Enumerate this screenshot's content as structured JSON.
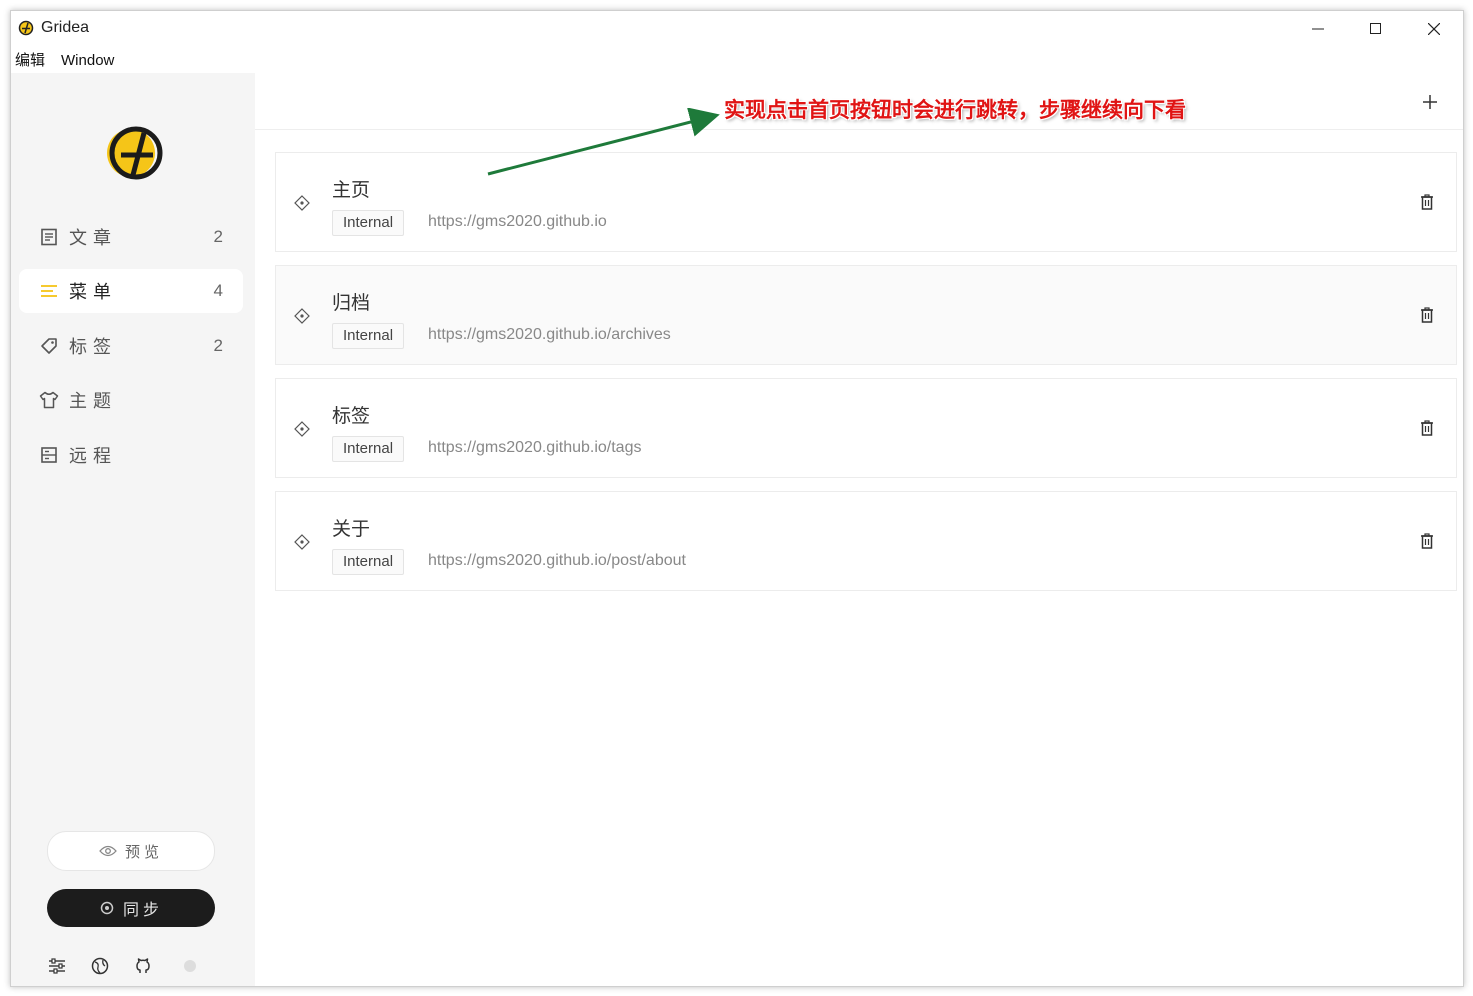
{
  "window": {
    "title": "Gridea",
    "controls": [
      "minimize",
      "maximize",
      "close"
    ]
  },
  "menubar": {
    "items": [
      "编辑",
      "Window"
    ]
  },
  "sidebar": {
    "items": [
      {
        "label": "文章",
        "count": "2",
        "icon": "article-icon",
        "active": false
      },
      {
        "label": "菜单",
        "count": "4",
        "icon": "menu-icon",
        "active": true
      },
      {
        "label": "标签",
        "count": "2",
        "icon": "tag-icon",
        "active": false
      },
      {
        "label": "主题",
        "count": "",
        "icon": "shirt-icon",
        "active": false
      },
      {
        "label": "远程",
        "count": "",
        "icon": "server-icon",
        "active": false
      }
    ],
    "preview_label": "预览",
    "sync_label": "同步",
    "accent_color": "#f5c518"
  },
  "main": {
    "menus": [
      {
        "name": "主页",
        "type": "Internal",
        "link": "https://gms2020.github.io"
      },
      {
        "name": "归档",
        "type": "Internal",
        "link": "https://gms2020.github.io/archives"
      },
      {
        "name": "标签",
        "type": "Internal",
        "link": "https://gms2020.github.io/tags"
      },
      {
        "name": "关于",
        "type": "Internal",
        "link": "https://gms2020.github.io/post/about"
      }
    ]
  },
  "annotation": {
    "text": "实现点击首页按钮时会进行跳转，步骤继续向下看",
    "color": "#e01414",
    "arrow_color": "#1e7a3a"
  }
}
